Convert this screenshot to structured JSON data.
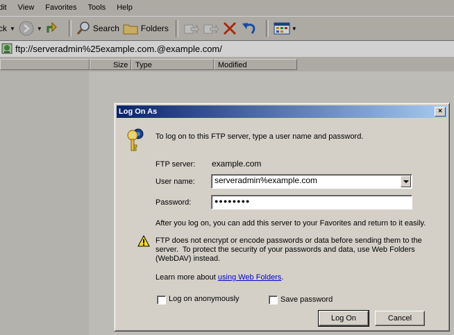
{
  "explorer": {
    "menu": [
      "dit",
      "View",
      "Favorites",
      "Tools",
      "Help"
    ],
    "toolbar": {
      "back_label": "ck",
      "search_label": "Search",
      "folders_label": "Folders"
    },
    "address": "ftp://serveradmin%25example.com.@example.com/",
    "columns": [
      "Size",
      "Type",
      "Modified"
    ]
  },
  "dialog": {
    "title": "Log On As",
    "close_glyph": "×",
    "intro": "To log on to this FTP server, type a user name and password.",
    "ftp_server_label": "FTP server:",
    "ftp_server_value": "example.com",
    "username_label": "User name:",
    "username_value": "serveradmin%example.com",
    "password_label": "Password:",
    "password_mask": "●●●●●●●●",
    "favorites_note": "After you log on, you can add this server to your Favorites and return to it easily.",
    "warning_line1": "FTP does not encrypt or encode passwords or data before sending them to the",
    "warning_line2": "server.  To protect the security of your passwords and data, use Web Folders",
    "warning_line3": "(WebDAV) instead.",
    "learn_more_prefix": "Learn more about ",
    "learn_more_link": "using Web Folders",
    "learn_more_suffix": ".",
    "anon_label": "Log on anonymously",
    "save_password_label": "Save password",
    "logon_button": "Log On",
    "cancel_button": "Cancel"
  },
  "colors": {
    "title_start": "#0a246a",
    "title_end": "#a6caf0",
    "link": "#0000cc",
    "face": "#d4d0c8"
  }
}
